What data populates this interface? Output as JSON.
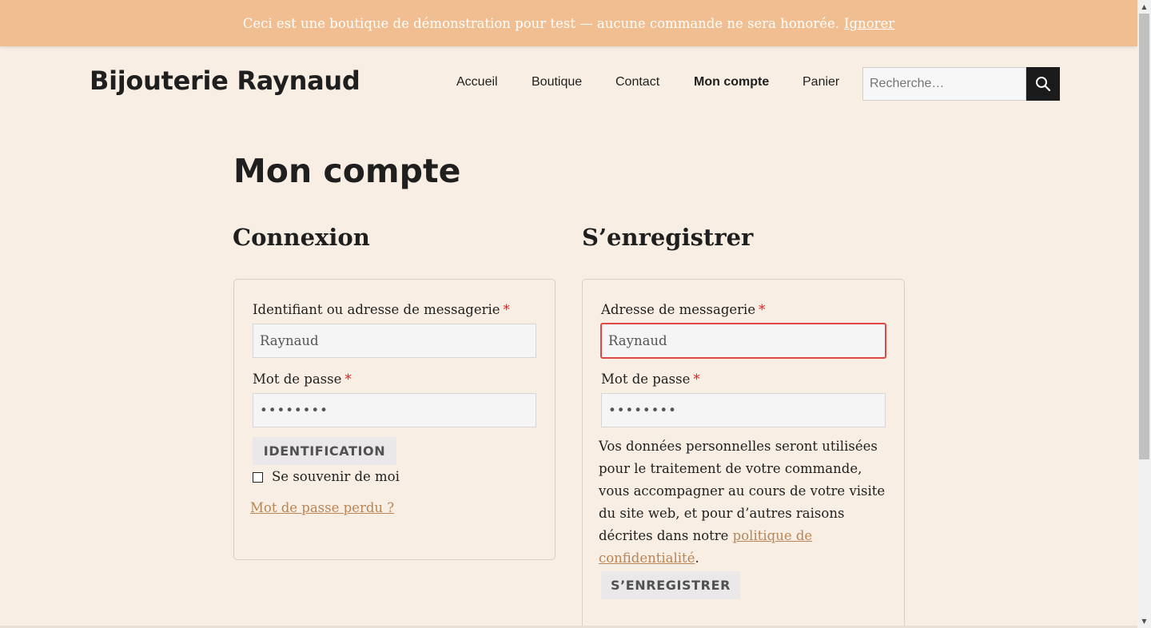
{
  "notice": {
    "text": "Ceci est une boutique de démonstration pour test — aucune commande ne sera honorée.",
    "dismiss_label": "Ignorer"
  },
  "header": {
    "site_title": "Bijouterie Raynaud",
    "nav": [
      {
        "label": "Accueil",
        "active": false
      },
      {
        "label": "Boutique",
        "active": false
      },
      {
        "label": "Contact",
        "active": false
      },
      {
        "label": "Mon compte",
        "active": true
      },
      {
        "label": "Panier",
        "active": false
      }
    ],
    "search": {
      "placeholder": "Recherche…",
      "icon": "search-icon"
    }
  },
  "main": {
    "page_title": "Mon compte",
    "login": {
      "title": "Connexion",
      "username_label": "Identifiant ou adresse de messagerie",
      "username_value": "Raynaud",
      "password_label": "Mot de passe",
      "password_value": "••••••••",
      "required_mark": "*",
      "submit_label": "IDENTIFICATION",
      "remember_label": "Se souvenir de moi",
      "lost_password_label": "Mot de passe perdu ?"
    },
    "register": {
      "title": "S’enregistrer",
      "email_label": "Adresse de messagerie",
      "email_value": "Raynaud",
      "password_label": "Mot de passe",
      "password_value": "••••••••",
      "required_mark": "*",
      "privacy_text": "Vos données personnelles seront utilisées pour le traitement de votre commande, vous accompagner au cours de votre visite du site web, et pour d’autres raisons décrites dans notre",
      "privacy_link": "politique de confidentialité",
      "privacy_end": ".",
      "submit_label": "S’ENREGISTRER"
    }
  },
  "colors": {
    "notice_bg": "#f0be90",
    "page_bg": "#f8eee3",
    "accent_link": "#b98556",
    "error_border": "#e04848",
    "required": "#dd1f1f"
  }
}
